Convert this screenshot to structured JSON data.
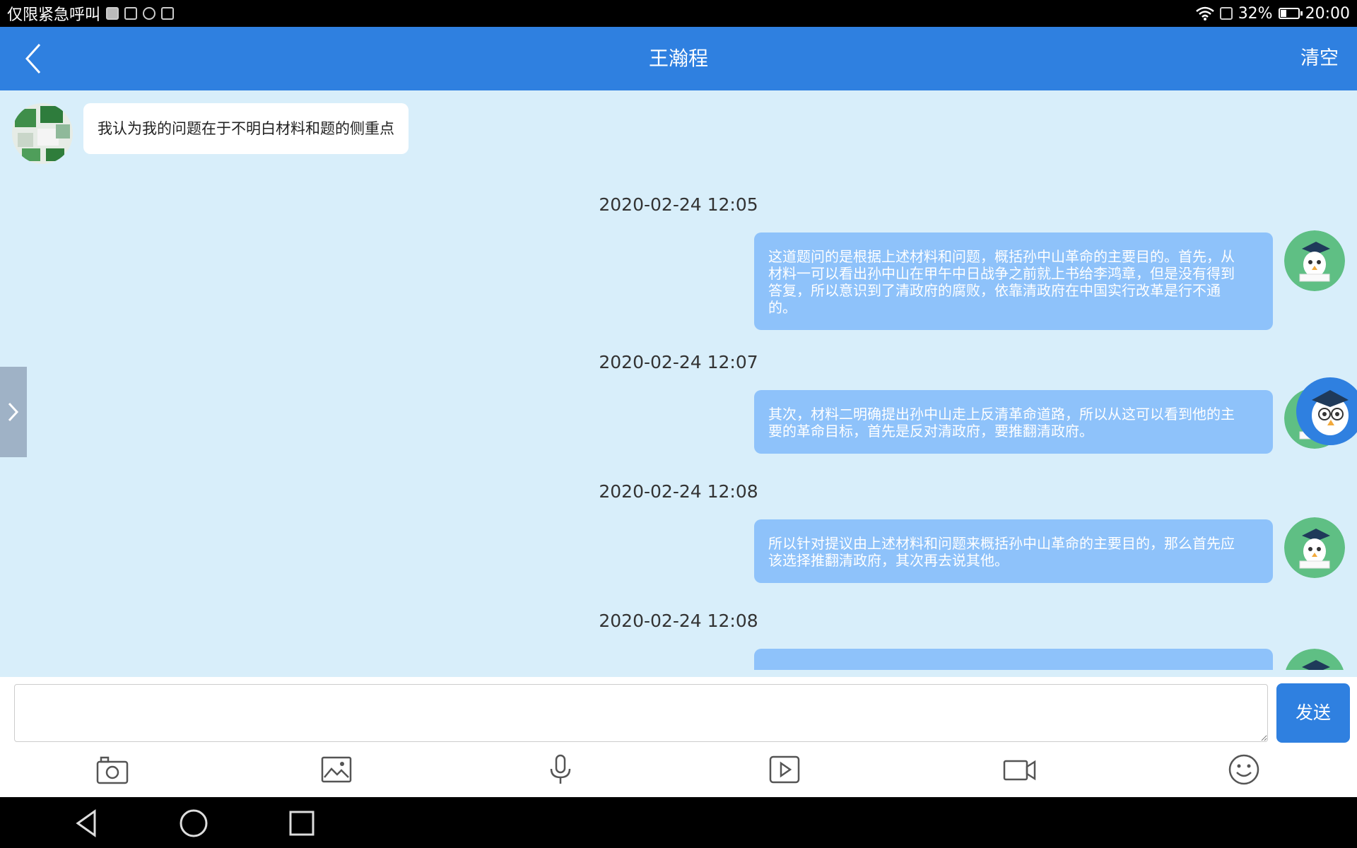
{
  "status_bar": {
    "carrier": "仅限紧急呼叫",
    "battery": "32%",
    "battery_level": 0.32,
    "time": "20:00"
  },
  "header": {
    "title": "王瀚程",
    "clear_label": "清空"
  },
  "messages": [
    {
      "direction": "incoming",
      "text": "我认为我的问题在于不明白材料和题的侧重点"
    },
    {
      "direction": "outgoing",
      "timestamp": "2020-02-24 12:05",
      "lines": [
        "这道题问的是根据上述材料和问题，概括孙中山革命的主要目的。首先，从",
        "材料一可以看出孙中山在甲午中日战争之前就上书给李鸿章，但是没有得到",
        "答复，所以意识到了清政府的腐败，依靠清政府在中国实行改革是行不通",
        "的。"
      ]
    },
    {
      "direction": "outgoing",
      "timestamp": "2020-02-24 12:07",
      "lines": [
        "其次，材料二明确提出孙中山走上反清革命道路，所以从这可以看到他的主",
        "要的革命目标，首先是反对清政府，要推翻清政府。"
      ]
    },
    {
      "direction": "outgoing",
      "timestamp": "2020-02-24 12:08",
      "lines": [
        "所以针对提议由上述材料和问题来概括孙中山革命的主要目的，那么首先应",
        "该选择推翻清政府，其次再去说其他。"
      ]
    },
    {
      "direction": "outgoing",
      "timestamp": "2020-02-24 12:08",
      "lines": []
    }
  ],
  "input": {
    "placeholder": "",
    "value": "",
    "send_label": "发送"
  },
  "toolbar_icons": [
    "camera-icon",
    "image-icon",
    "microphone-icon",
    "video-play-icon",
    "video-camera-icon",
    "emoji-icon"
  ],
  "nav_icons": [
    "back-triangle-icon",
    "home-circle-icon",
    "recents-square-icon"
  ],
  "colors": {
    "header": "#2f80e0",
    "chat_background": "#d8eefa",
    "outgoing_bubble": "#8ec2fa",
    "incoming_bubble": "#ffffff",
    "send_button": "#2f80e0"
  }
}
